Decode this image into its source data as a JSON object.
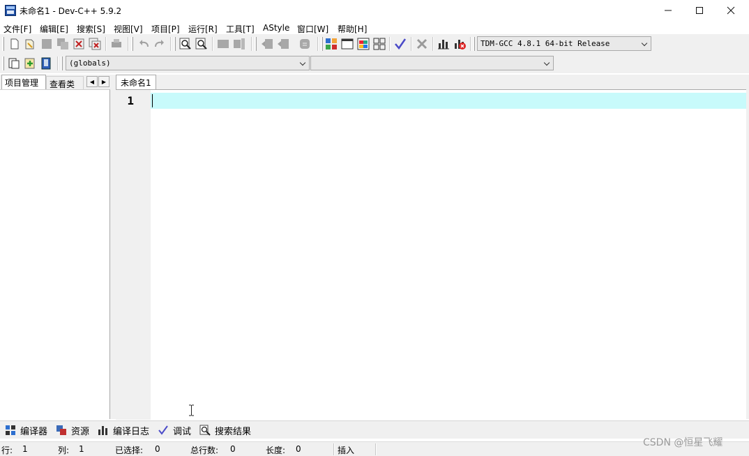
{
  "window": {
    "title": "未命名1 - Dev-C++ 5.9.2"
  },
  "menu": [
    {
      "label": "文件[F]"
    },
    {
      "label": "编辑[E]"
    },
    {
      "label": "搜索[S]"
    },
    {
      "label": "视图[V]"
    },
    {
      "label": "项目[P]"
    },
    {
      "label": "运行[R]"
    },
    {
      "label": "工具[T]"
    },
    {
      "label": "AStyle"
    },
    {
      "label": "窗口[W]"
    },
    {
      "label": "帮助[H]"
    }
  ],
  "toolbar": {
    "compiler_selected": "TDM-GCC 4.8.1 64-bit Release",
    "scope_selected": "(globals)",
    "function_selected": ""
  },
  "left_panel": {
    "tabs": [
      "项目管理",
      "查看类"
    ]
  },
  "editor": {
    "tab_label": "未命名1",
    "line_numbers": [
      "1"
    ],
    "colors": {
      "current_line": "#c8fafb",
      "gutter": "#f0f0f0"
    }
  },
  "bottom_tabs": [
    {
      "label": "编译器",
      "icon": "grid-icon"
    },
    {
      "label": "资源",
      "icon": "resources-icon"
    },
    {
      "label": "编译日志",
      "icon": "bar-chart-icon"
    },
    {
      "label": "调试",
      "icon": "check-icon"
    },
    {
      "label": "搜索结果",
      "icon": "search-doc-icon"
    }
  ],
  "status": {
    "row_label": "行:",
    "row_value": "1",
    "col_label": "列:",
    "col_value": "1",
    "sel_label": "已选择:",
    "sel_value": "0",
    "total_label": "总行数:",
    "total_value": "0",
    "len_label": "长度:",
    "len_value": "0",
    "mode": "插入"
  },
  "watermark": "CSDN @恒星飞耀"
}
